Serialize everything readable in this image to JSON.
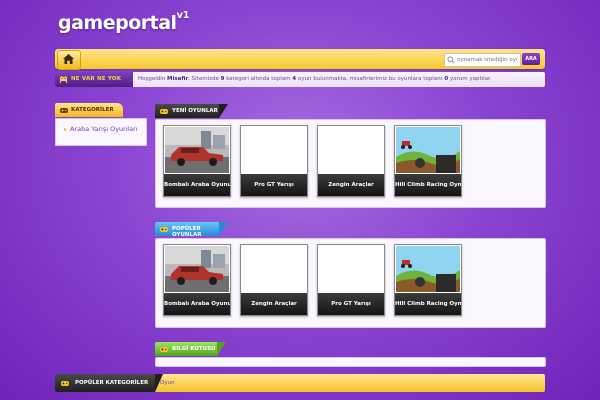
{
  "logo": {
    "name": "gameportal",
    "version": "v1"
  },
  "header": {
    "search_placeholder": "oynamak istediğin oyun",
    "search_button": "ARA"
  },
  "info": {
    "label": "NE VAR NE YOK",
    "prefix": "Hoşgeldin ",
    "user": "Misafir",
    "mid1": ", Sitemizde ",
    "categories_count": "9",
    "mid2": " kategori altında toplam ",
    "games_count": "4",
    "mid3": " oyun bulunmakta, misafirlerimiz bu oyunlara toplam ",
    "comments_count": "0",
    "suffix": " yorum yaptılar."
  },
  "sidebar": {
    "title": "KATEGORİLER",
    "items": [
      {
        "label": "Araba Yarışı Oyunları"
      }
    ]
  },
  "sections": {
    "new": {
      "title": "YENİ OYUNLAR",
      "games": [
        {
          "title": "Bombalı Araba Oyunu",
          "thumb": "car"
        },
        {
          "title": "Pro GT Yarışı",
          "thumb": "blank"
        },
        {
          "title": "Zengin Araçlar",
          "thumb": "blank"
        },
        {
          "title": "Hill Climb Racing Oyna",
          "thumb": "hill"
        }
      ]
    },
    "popular": {
      "title": "POPÜLER OYUNLAR",
      "games": [
        {
          "title": "Bombalı Araba Oyunu",
          "thumb": "car"
        },
        {
          "title": "Zengin Araçlar",
          "thumb": "blank"
        },
        {
          "title": "Pro GT Yarışı",
          "thumb": "blank"
        },
        {
          "title": "Hill Climb Racing Oyna",
          "thumb": "hill"
        }
      ]
    },
    "info_box": {
      "title": "BİLGİ KUTUSU"
    }
  },
  "bottom": {
    "title": "POPÜLER KATEGORİLER",
    "link": "Oyun"
  }
}
